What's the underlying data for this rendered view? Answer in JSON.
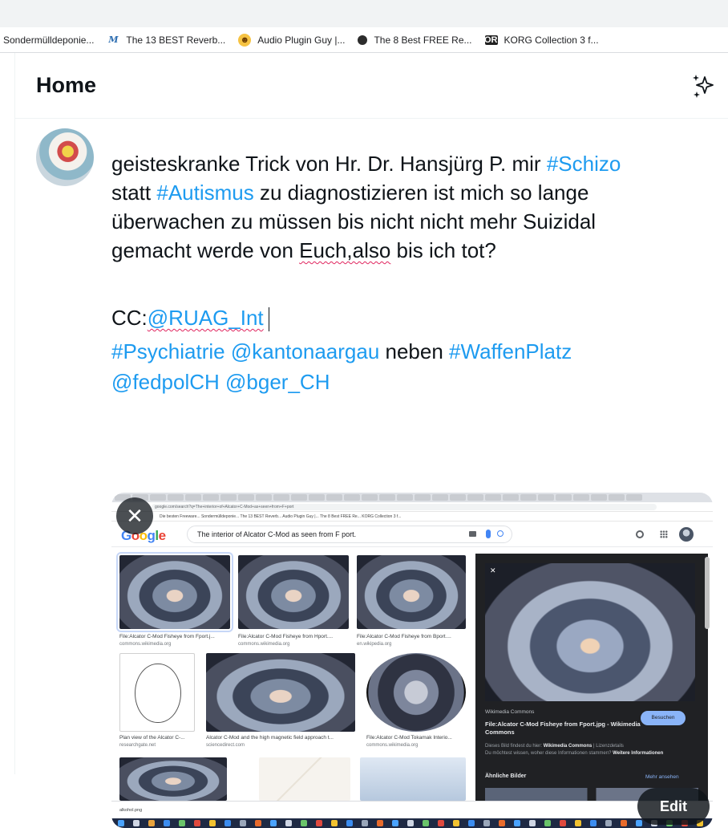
{
  "browser": {
    "bookmarks": [
      {
        "label": "Sondermülldeponie...",
        "icon": "page-icon"
      },
      {
        "label": "The 13 BEST Reverb...",
        "icon": "m-logo-icon"
      },
      {
        "label": "Audio Plugin Guy |...",
        "icon": "audio-plugin-guy-icon"
      },
      {
        "label": "The 8 Best FREE Re...",
        "icon": "dark-circle-icon"
      },
      {
        "label": "KORG Collection 3 f...",
        "icon": "korg-icon",
        "icon_text": "KORG"
      }
    ]
  },
  "header": {
    "title": "Home",
    "sparkle_icon": "sparkle-icon"
  },
  "tweet": {
    "line1_a": "geisteskranke Trick von Hr. Dr. Hansjürg P. mir ",
    "line1_tag": "#Schizo",
    "line2_a": "statt ",
    "line2_tag": "#Autismus",
    "line2_b": " zu diagnostizieren ist mich so lange",
    "line3": "überwachen zu müssen bis nicht nicht mehr Suizidal",
    "line4_a": "gemacht werde von ",
    "line4_err": "Euch,also",
    "line4_b": " bis ich tot?",
    "cc_prefix": "CC:",
    "cc_mention": "@RUAG_Int",
    "tag_psych": "#Psychiatrie",
    "mention_aargau": "@kantonaargau",
    "word_neben": " neben ",
    "tag_waffen": "#WaffenPlatz",
    "mention_fedpol": "@fedpolCH",
    "mention_bger": "@bger_CH",
    "accent_color": "#1d9bf0"
  },
  "media": {
    "close_symbol": "✕",
    "edit_label": "Edit",
    "screenshot": {
      "url_text": "google.com/search?q=The+interior+of+Alcator+C-Mod+as+seen+from+F+port",
      "bookmarks_text": "Die besten Freeware... Sondermülldeponie... The 13 BEST Reverb... Audio Plugin Guy |... The 8 Best FREE Re... KORG Collection 3 f...",
      "search_query": "The interior of Alcator C-Mod as seen from F port.",
      "results": [
        {
          "caption": "File:Alcator C-Mod Fisheye from Fport.j...",
          "source": "commons.wikimedia.org"
        },
        {
          "caption": "File:Alcator C-Mod Fisheye from Hport....",
          "source": "commons.wikimedia.org"
        },
        {
          "caption": "File:Alcator C-Mod Fisheye from Bport....",
          "source": "en.wikipedia.org"
        },
        {
          "caption": "Plan view of the Alcator C-...",
          "source": "researchgate.net"
        },
        {
          "caption": "Alcator C-Mod and the high magnetic field approach t...",
          "source": "sciencedirect.com"
        },
        {
          "caption": "File:Alcator C-Mod Tokamak Interio...",
          "source": "commons.wikimedia.org"
        }
      ],
      "panel": {
        "source": "Wikimedia Commons",
        "title": "File:Alcator C-Mod Fisheye from Fport.jpg - Wikimedia Commons",
        "button": "Besuchen",
        "info_a": "Dieses Bild findest du hier: ",
        "info_b": "Wikimedia Commons",
        "info_c": " | Lizenzdetails",
        "info_d": "Du möchtest wissen, woher diese Informationen stammen? ",
        "info_e": "Weitere Informationen",
        "similar": "Ähnliche Bilder",
        "more": "Mehr ansehen"
      },
      "download_file": "alkohol.png"
    }
  }
}
